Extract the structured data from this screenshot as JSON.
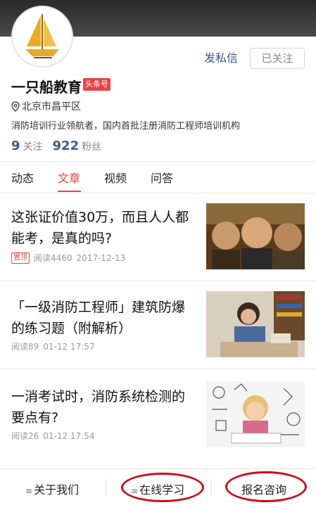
{
  "profile": {
    "name": "一只船教育",
    "badge": "头条号",
    "location": "北京市昌平区",
    "description": "消防培训行业领航者，国内首批注册消防工程师培训机构",
    "following_count": "9",
    "following_label": "关注",
    "followers_count": "922",
    "followers_label": "粉丝"
  },
  "actions": {
    "message_label": "发私信",
    "follow_label": "已关注"
  },
  "tabs": [
    {
      "label": "动态"
    },
    {
      "label": "文章"
    },
    {
      "label": "视频"
    },
    {
      "label": "问答"
    }
  ],
  "articles": [
    {
      "title": "这张证价值30万，而且人人都能考，是真的吗?",
      "pinned": "置顶",
      "reads": "阅读4460",
      "date": "2017-12-13"
    },
    {
      "title": "「一级消防工程师」建筑防爆的练习题（附解析）",
      "reads": "阅读89",
      "date": "01-12 17:57"
    },
    {
      "title": "一消考试时，消防系统检测的要点有?",
      "reads": "阅读26",
      "date": "01-12 17:54"
    }
  ],
  "bottom_bar": {
    "about_label": "关于我们",
    "learn_label": "在线学习",
    "consult_label": "报名咨询"
  },
  "colors": {
    "accent_red": "#e84343",
    "link_blue": "#3a5a8a",
    "annotation_red": "#c8101a"
  }
}
